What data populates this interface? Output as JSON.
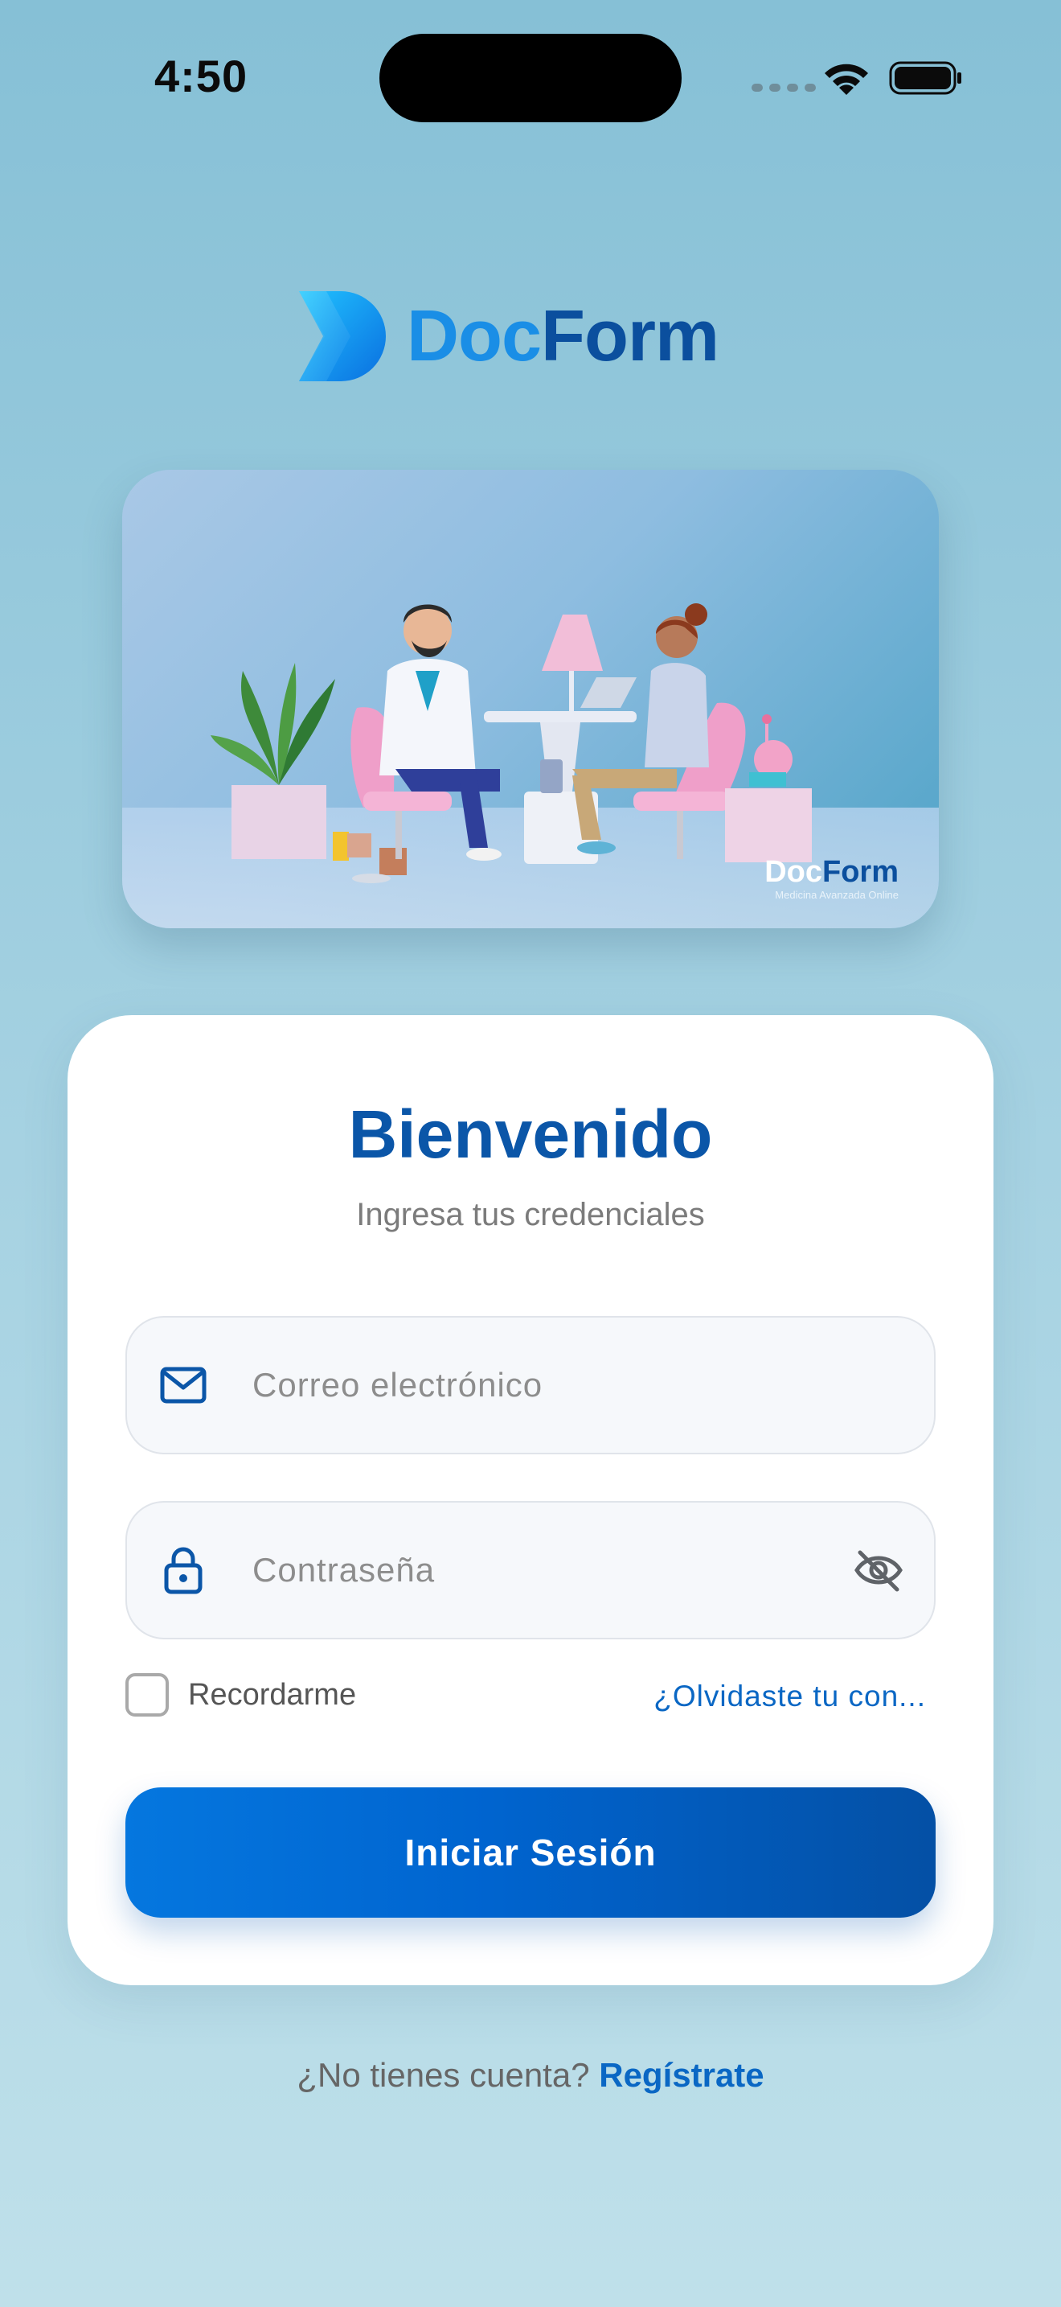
{
  "status_bar": {
    "time": "4:50"
  },
  "brand": {
    "name_part1": "Doc",
    "name_part2": "Form"
  },
  "hero": {
    "brand_part1": "Doc",
    "brand_part2": "Form",
    "brand_tagline": "Medicina Avanzada Online"
  },
  "login": {
    "title": "Bienvenido",
    "subtitle": "Ingresa tus credenciales",
    "email_placeholder": "Correo electrónico",
    "email_value": "",
    "password_placeholder": "Contraseña",
    "password_value": "",
    "remember_label": "Recordarme",
    "remember_checked": false,
    "forgot_link": "¿Olvidaste tu con...",
    "submit_label": "Iniciar Sesión"
  },
  "signup": {
    "prompt": "¿No tienes cuenta?",
    "link": "Regístrate"
  },
  "icons": {
    "email": "mail-icon",
    "password": "lock-icon",
    "toggle_visibility": "eye-off-icon"
  },
  "colors": {
    "primary": "#0b56a8",
    "accent": "#0a67c4",
    "button_start": "#0577df",
    "button_end": "#0450a5",
    "background_top": "#86c0d6",
    "background_bottom": "#bfe0ea"
  }
}
